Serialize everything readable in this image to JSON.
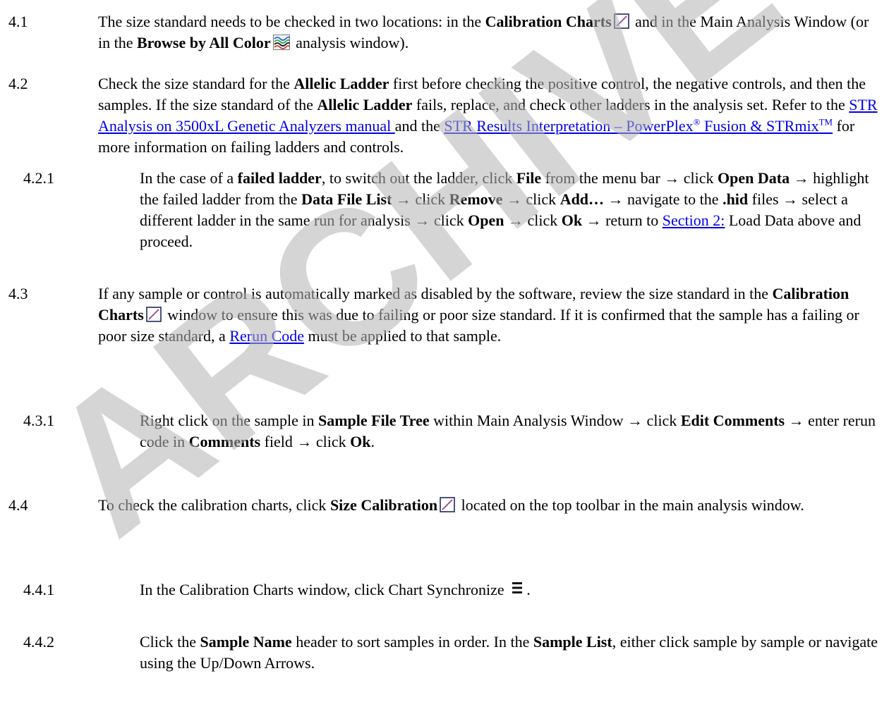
{
  "watermark": {
    "text": "ARCHIVE",
    "color": "#b3b3b3"
  },
  "items": {
    "i41": {
      "num": "4.1",
      "t1": "The size standard needs to be checked in two locations: in the ",
      "b1": "Calibration Charts",
      "t2": " and in the Main Analysis Window (or in the ",
      "b2": "Browse by All Color",
      "t3": " analysis window)."
    },
    "i42": {
      "num": "4.2",
      "t1": "Check the size standard for the ",
      "b1": "Allelic Ladder",
      "t2": " first before checking the positive control, the negative controls, and then the samples. If the size standard of the ",
      "b2": "Allelic Ladder",
      "t3": " fails, replace, and check other ladders in the analysis set. Refer to the ",
      "link1": "STR Analysis on 3500xL Genetic Analyzers manual ",
      "t4": " and the ",
      "link2a": "STR Results Interpretation – PowerPlex",
      "link2sup1": "®",
      "link2b": " Fusion & STRmix",
      "link2sup2": "TM",
      "t5": " for more information on failing ladders and controls."
    },
    "i421": {
      "num": "4.2.1",
      "t1": "In the case of a ",
      "b1": "failed ladder",
      "t2": ", to switch out the ladder, click ",
      "b2": "File",
      "t3": " from the menu bar → click ",
      "b3": "Open Data",
      "t4": " → highlight the failed ladder from the ",
      "b4": "Data File List",
      "t5": " → click ",
      "b5": "Remove",
      "t6": " → click ",
      "b6": "Add…",
      "t7": " → navigate to the ",
      "b7": ".hid",
      "t8": " files → select a different ladder in the same run for analysis → click ",
      "b8": "Open",
      "t9": " → click ",
      "b9": "Ok",
      "t10": " → return to ",
      "link1": "Section 2:",
      "t11": " Load Data above and proceed."
    },
    "i43": {
      "num": "4.3",
      "t1": "If any sample or control is automatically marked as disabled by the software, review the size standard in the ",
      "b1": "Calibration Charts",
      "t2": " window to ensure this was due to failing or poor size standard. If it is confirmed that the sample has a failing or poor size standard, a ",
      "link1": "Rerun Code",
      "t3": " must be applied to that sample."
    },
    "i431": {
      "num": "4.3.1",
      "t1": "Right click on the sample in ",
      "b1": "Sample File Tree",
      "t2": " within Main Analysis Window → click ",
      "b2": "Edit Comments",
      "t3": " → enter rerun code in ",
      "b3": "Comments",
      "t4": " field → click ",
      "b4": "Ok",
      "t5": "."
    },
    "i44": {
      "num": "4.4",
      "t1": "To check the calibration charts, click ",
      "b1": "Size Calibration",
      "t2": " located on the top toolbar in the main analysis window."
    },
    "i441": {
      "num": "4.4.1",
      "t1": "In the Calibration Charts window, click Chart Synchronize ",
      "t2": "."
    },
    "i442": {
      "num": "4.4.2",
      "t1": "Click the ",
      "b1": "Sample Name",
      "t2": " header to sort samples in order. In the ",
      "b2": "Sample List",
      "t3": ", either click sample by sample or navigate using the Up/Down Arrows."
    }
  }
}
